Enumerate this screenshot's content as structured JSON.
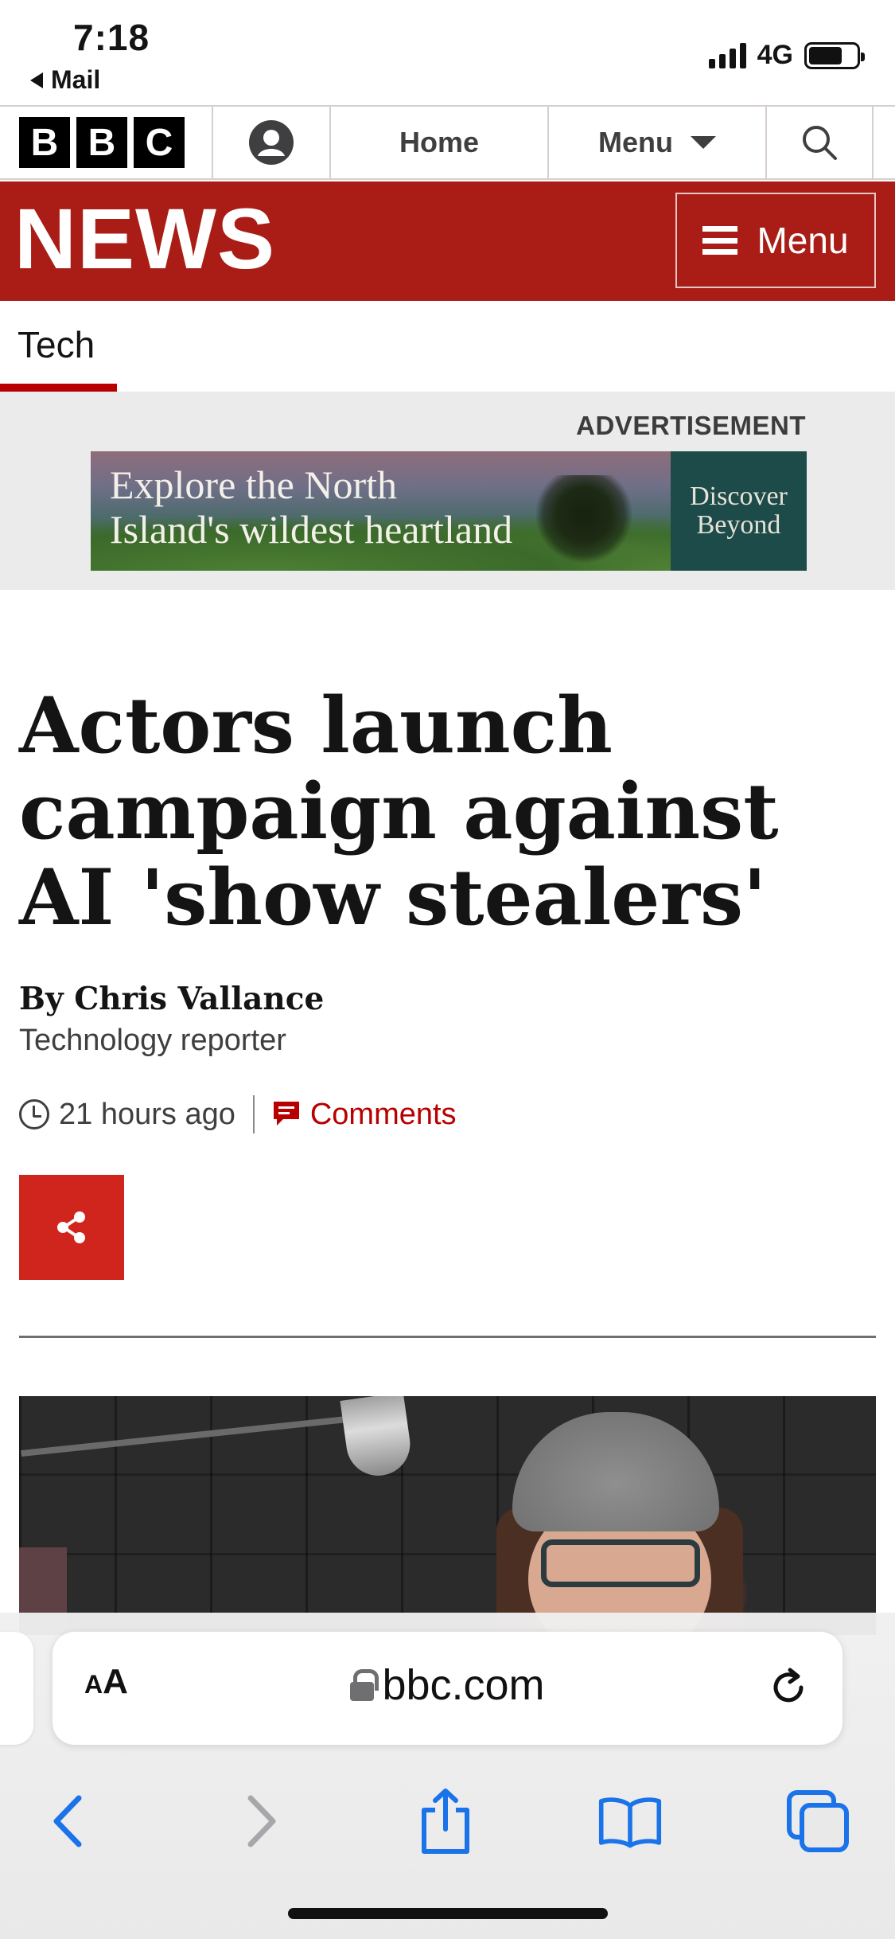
{
  "status_bar": {
    "time": "7:18",
    "back_label": "Mail",
    "network": "4G",
    "signal_bars": 4,
    "battery_level": 0.7
  },
  "bbc_nav": {
    "logo_letters": [
      "B",
      "B",
      "C"
    ],
    "account_icon": "account-icon",
    "home_label": "Home",
    "menu_label": "Menu",
    "search_icon": "search-icon"
  },
  "news_banner": {
    "title": "NEWS",
    "menu_label": "Menu",
    "color": "#a91d16"
  },
  "section": {
    "current_tab": "Tech",
    "accent": "#b80000"
  },
  "advertisement": {
    "label": "ADVERTISEMENT",
    "headline_line1": "Explore the North",
    "headline_line2": "Island's wildest heartland",
    "brand_line1": "Discover",
    "brand_line2": "Beyond"
  },
  "article": {
    "headline": "Actors launch campaign against AI 'show stealers'",
    "author": "By Chris Vallance",
    "role": "Technology reporter",
    "timestamp": "21 hours ago",
    "comments_label": "Comments",
    "share_icon": "share-icon",
    "share_color": "#d0251c"
  },
  "browser": {
    "text_size_label_small": "A",
    "text_size_label_large": "A",
    "url": "bbc.com",
    "reload_icon": "reload-icon",
    "back_icon": "back-arrow-icon",
    "forward_icon": "forward-arrow-icon",
    "share_icon": "share-icon",
    "bookmarks_icon": "bookmarks-icon",
    "tabs_icon": "tabs-icon",
    "accent": "#1a73e8"
  }
}
